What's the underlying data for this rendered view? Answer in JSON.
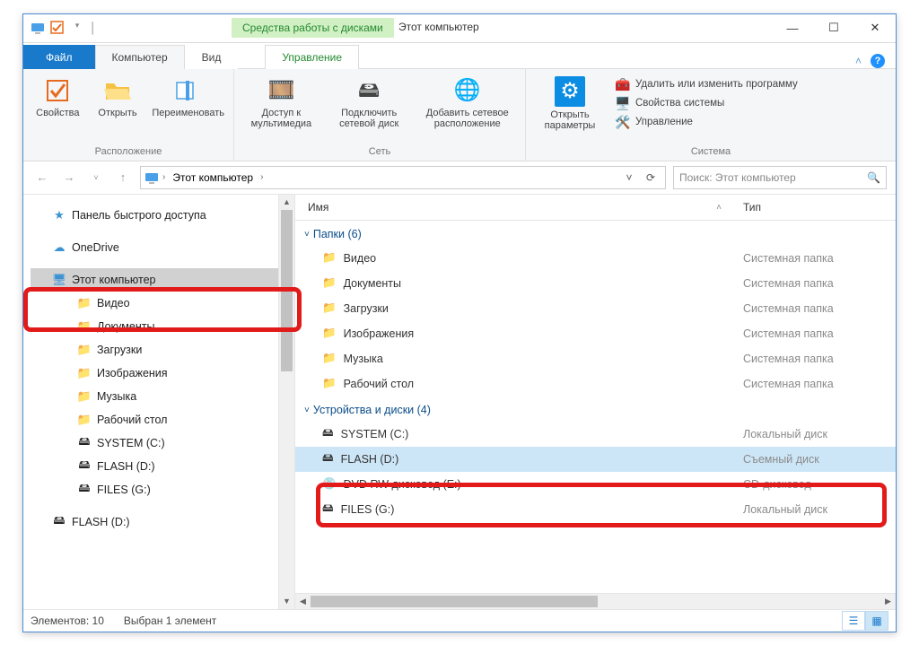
{
  "title": "Этот компьютер",
  "context_group": "Средства работы с дисками",
  "tabs": {
    "file": "Файл",
    "computer": "Компьютер",
    "view": "Вид",
    "drive": "Управление"
  },
  "ribbon": {
    "group_location": {
      "label": "Расположение",
      "props": "Свойства",
      "open": "Открыть",
      "rename": "Переименовать"
    },
    "group_network": {
      "label": "Сеть",
      "media": "Доступ к мультимедиа",
      "map": "Подключить сетевой диск",
      "addnet": "Добавить сетевое расположение"
    },
    "group_system": {
      "label": "Система",
      "opensettings": "Открыть параметры",
      "uninstall": "Удалить или изменить программу",
      "sysprops": "Свойства системы",
      "manage": "Управление"
    }
  },
  "addr": {
    "root": "Этот компьютер"
  },
  "search_placeholder": "Поиск: Этот компьютер",
  "columns": {
    "name": "Имя",
    "type": "Тип"
  },
  "tree": {
    "quick": "Панель быстрого доступа",
    "onedrive": "OneDrive",
    "thispc": "Этот компьютер",
    "videos": "Видео",
    "documents": "Документы",
    "downloads": "Загрузки",
    "pictures": "Изображения",
    "music": "Музыка",
    "desktop": "Рабочий стол",
    "systemc": "SYSTEM (C:)",
    "flashd": "FLASH (D:)",
    "filesg": "FILES (G:)",
    "flashd2": "FLASH (D:)"
  },
  "groups": {
    "folders": "Папки (6)",
    "drives": "Устройства и диски (4)"
  },
  "items": {
    "videos": {
      "n": "Видео",
      "t": "Системная папка"
    },
    "documents": {
      "n": "Документы",
      "t": "Системная папка"
    },
    "downloads": {
      "n": "Загрузки",
      "t": "Системная папка"
    },
    "pictures": {
      "n": "Изображения",
      "t": "Системная папка"
    },
    "music": {
      "n": "Музыка",
      "t": "Системная папка"
    },
    "desktop": {
      "n": "Рабочий стол",
      "t": "Системная папка"
    },
    "systemc": {
      "n": "SYSTEM (C:)",
      "t": "Локальный диск"
    },
    "flashd": {
      "n": "FLASH (D:)",
      "t": "Съемный диск"
    },
    "dvd": {
      "n": "DVD RW дисковод (E:)",
      "t": "CD-дисковод"
    },
    "filesg": {
      "n": "FILES (G:)",
      "t": "Локальный диск"
    }
  },
  "status": {
    "count": "Элементов: 10",
    "sel": "Выбран 1 элемент"
  }
}
